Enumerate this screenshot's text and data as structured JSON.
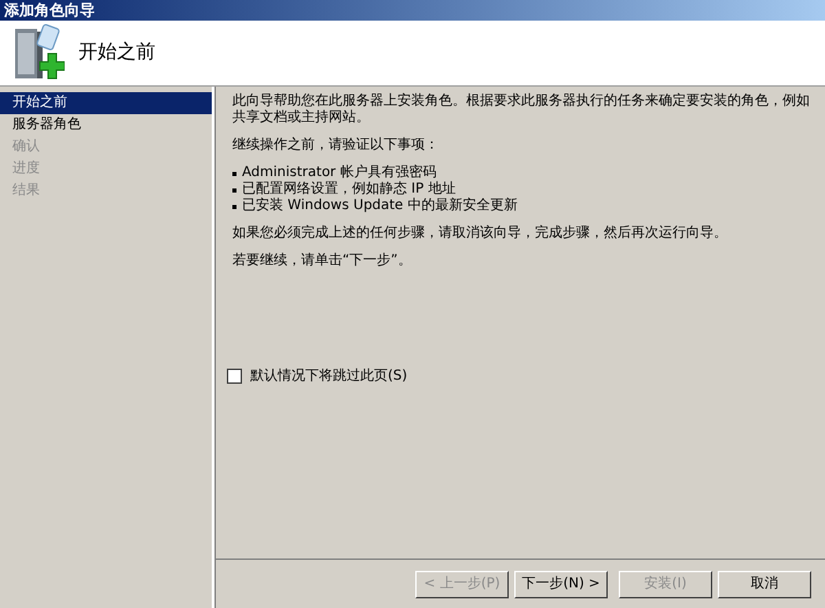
{
  "window": {
    "title": "添加角色向导"
  },
  "header": {
    "title": "开始之前"
  },
  "sidebar": {
    "items": [
      {
        "label": "开始之前",
        "selected": true,
        "disabled": false
      },
      {
        "label": "服务器角色",
        "selected": false,
        "disabled": false
      },
      {
        "label": "确认",
        "selected": false,
        "disabled": true
      },
      {
        "label": "进度",
        "selected": false,
        "disabled": true
      },
      {
        "label": "结果",
        "selected": false,
        "disabled": true
      }
    ]
  },
  "content": {
    "paragraphs": [
      {
        "kind": "text",
        "text": "此向导帮助您在此服务器上安装角色。根据要求此服务器执行的任务来确定要安装的角色，例如共享文档或主持网站。"
      },
      {
        "kind": "text",
        "text": "继续操作之前，请验证以下事项："
      },
      {
        "kind": "bullets",
        "items": [
          "Administrator 帐户具有强密码",
          "已配置网络设置，例如静态 IP 地址",
          "已安装 Windows Update 中的最新安全更新"
        ]
      },
      {
        "kind": "text",
        "text": "如果您必须完成上述的任何步骤，请取消该向导，完成步骤，然后再次运行向导。"
      },
      {
        "kind": "text",
        "text": "若要继续，请单击“下一步”。"
      }
    ]
  },
  "skip_checkbox": {
    "label": "默认情况下将跳过此页(S)",
    "checked": false
  },
  "buttons": [
    {
      "label": "< 上一步(P)",
      "disabled": true
    },
    {
      "label": "下一步(N) >",
      "disabled": false
    },
    {
      "label": "安装(I)",
      "disabled": true
    },
    {
      "label": "取消",
      "disabled": false
    }
  ]
}
